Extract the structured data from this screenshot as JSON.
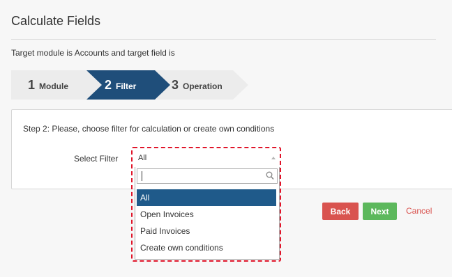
{
  "page": {
    "title": "Calculate Fields",
    "target_text": "Target module is Accounts and target field is"
  },
  "wizard": {
    "steps": [
      {
        "number": "1",
        "label": "Module",
        "state": "done"
      },
      {
        "number": "2",
        "label": "Filter",
        "state": "active"
      },
      {
        "number": "3",
        "label": "Operation",
        "state": "pending"
      }
    ]
  },
  "panel": {
    "instruction": "Step 2: Please, choose filter for calculation or create own conditions",
    "select_label": "Select Filter"
  },
  "filter_select": {
    "value": "All",
    "search_value": "",
    "options": [
      "All",
      "Open Invoices",
      "Paid Invoices",
      "Create own conditions"
    ],
    "selected_index": 0
  },
  "buttons": {
    "back": "Back",
    "next": "Next",
    "cancel": "Cancel"
  },
  "colors": {
    "active_step": "#1f4e7a",
    "inactive_step": "#ececec",
    "back": "#d9534f",
    "next": "#5cb85c",
    "highlight": "#e0152a",
    "selected_option": "#1f5a8a"
  }
}
